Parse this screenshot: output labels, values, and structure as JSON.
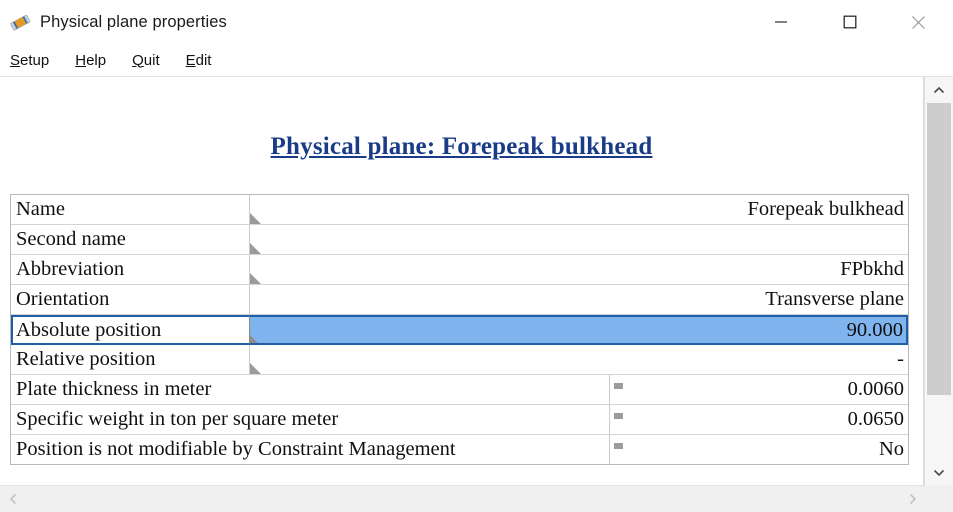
{
  "window": {
    "title": "Physical plane properties",
    "icon": "roller-brush-icon",
    "controls": {
      "minimize": "minimize-button",
      "maximize": "maximize-button",
      "close": "close-button"
    }
  },
  "menubar": {
    "items": [
      {
        "label": "Setup",
        "accel": "S",
        "rest": "etup"
      },
      {
        "label": "Help",
        "accel": "H",
        "rest": "elp"
      },
      {
        "label": "Quit",
        "accel": "Q",
        "rest": "uit"
      },
      {
        "label": "Edit",
        "accel": "E",
        "rest": "dit"
      }
    ]
  },
  "content": {
    "heading": "Physical plane: Forepeak bulkhead",
    "heading_color": "#1a3c87",
    "selection_color": "#7fb4ef",
    "selection_border_color": "#1e5fa8",
    "rows": [
      {
        "label": "Name",
        "value": "Forepeak bulkhead",
        "divider": "narrow",
        "grip": "triangle",
        "selected": false
      },
      {
        "label": "Second name",
        "value": "",
        "divider": "narrow",
        "grip": "triangle",
        "selected": false
      },
      {
        "label": "Abbreviation",
        "value": "FPbkhd",
        "divider": "narrow",
        "grip": "triangle",
        "selected": false
      },
      {
        "label": "Orientation",
        "value": "Transverse plane",
        "divider": "narrow",
        "grip": "none",
        "selected": false
      },
      {
        "label": "Absolute position",
        "value": "90.000",
        "divider": "narrow",
        "grip": "triangle",
        "selected": true
      },
      {
        "label": "Relative position",
        "value": "-",
        "divider": "narrow",
        "grip": "triangle",
        "selected": false
      },
      {
        "label": "Plate thickness in meter",
        "value": "0.0060",
        "divider": "wide",
        "grip": "square",
        "selected": false
      },
      {
        "label": "Specific weight in ton per square meter",
        "value": "0.0650",
        "divider": "wide",
        "grip": "square",
        "selected": false
      },
      {
        "label": "Position is not modifiable by Constraint Management",
        "value": "No",
        "divider": "wide",
        "grip": "square",
        "selected": false
      }
    ]
  },
  "scrollbars": {
    "vertical": {
      "up": "scroll-up-arrow",
      "down": "scroll-down-arrow"
    },
    "horizontal": {
      "left": "scroll-left-arrow",
      "right": "scroll-right-arrow"
    }
  }
}
